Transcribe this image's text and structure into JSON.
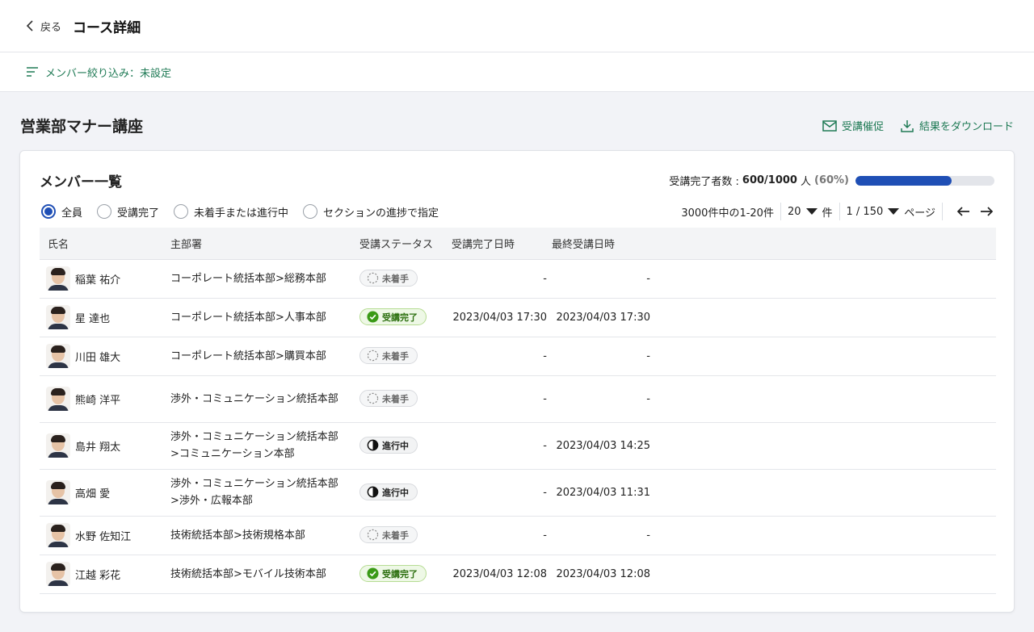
{
  "header": {
    "back_label": "戻る",
    "title": "コース詳細"
  },
  "filter": {
    "label": "メンバー絞り込み：未設定"
  },
  "course": {
    "title": "営業部マナー講座"
  },
  "actions": {
    "remind": "受講催促",
    "download": "結果をダウンロード"
  },
  "list": {
    "title": "メンバー一覧",
    "progress_prefix": "受講完了者数 : ",
    "progress_count": "600/1000",
    "progress_unit": "人",
    "progress_pct": "(60%)",
    "progress_fraction": 0.69,
    "progress_color": "#1f4fb5"
  },
  "radios": [
    {
      "label": "全員",
      "checked": true
    },
    {
      "label": "受講完了",
      "checked": false
    },
    {
      "label": "未着手または進行中",
      "checked": false
    },
    {
      "label": "セクションの進捗で指定",
      "checked": false
    }
  ],
  "pager": {
    "summary": "3000件中の1-20件",
    "per_page": "20",
    "per_page_unit": "件",
    "page": "1 / 150",
    "page_unit": "ページ"
  },
  "table": {
    "headers": [
      "氏名",
      "主部署",
      "受講ステータス",
      "受講完了日時",
      "最終受講日時"
    ],
    "rows": [
      {
        "name": "稲葉 祐介",
        "dept": "コーポレート統括本部>総務本部",
        "status": "未着手",
        "status_type": "not-started",
        "completed": "-",
        "last": "-"
      },
      {
        "name": "星 達也",
        "dept": "コーポレート統括本部>人事本部",
        "status": "受講完了",
        "status_type": "done",
        "completed": "2023/04/03 17:30",
        "last": "2023/04/03 17:30"
      },
      {
        "name": "川田 雄大",
        "dept": "コーポレート統括本部>購買本部",
        "status": "未着手",
        "status_type": "not-started",
        "completed": "-",
        "last": "-"
      },
      {
        "name": "熊崎 洋平",
        "dept": "渉外・コミュニケーション統括本部",
        "status": "未着手",
        "status_type": "not-started",
        "completed": "-",
        "last": "-"
      },
      {
        "name": "島井 翔太",
        "dept": "渉外・コミュニケーション統括本部>コミュニケーション本部",
        "status": "進行中",
        "status_type": "in-progress",
        "completed": "-",
        "last": "2023/04/03 14:25"
      },
      {
        "name": "高畑 愛",
        "dept": "渉外・コミュニケーション統括本部>渉外・広報本部",
        "status": "進行中",
        "status_type": "in-progress",
        "completed": "-",
        "last": "2023/04/03 11:31"
      },
      {
        "name": "水野 佐知江",
        "dept": "技術統括本部>技術規格本部",
        "status": "未着手",
        "status_type": "not-started",
        "completed": "-",
        "last": "-"
      },
      {
        "name": "江越 彩花",
        "dept": "技術統括本部>モバイル技術本部",
        "status": "受講完了",
        "status_type": "done",
        "completed": "2023/04/03 12:08",
        "last": "2023/04/03 12:08"
      }
    ]
  }
}
